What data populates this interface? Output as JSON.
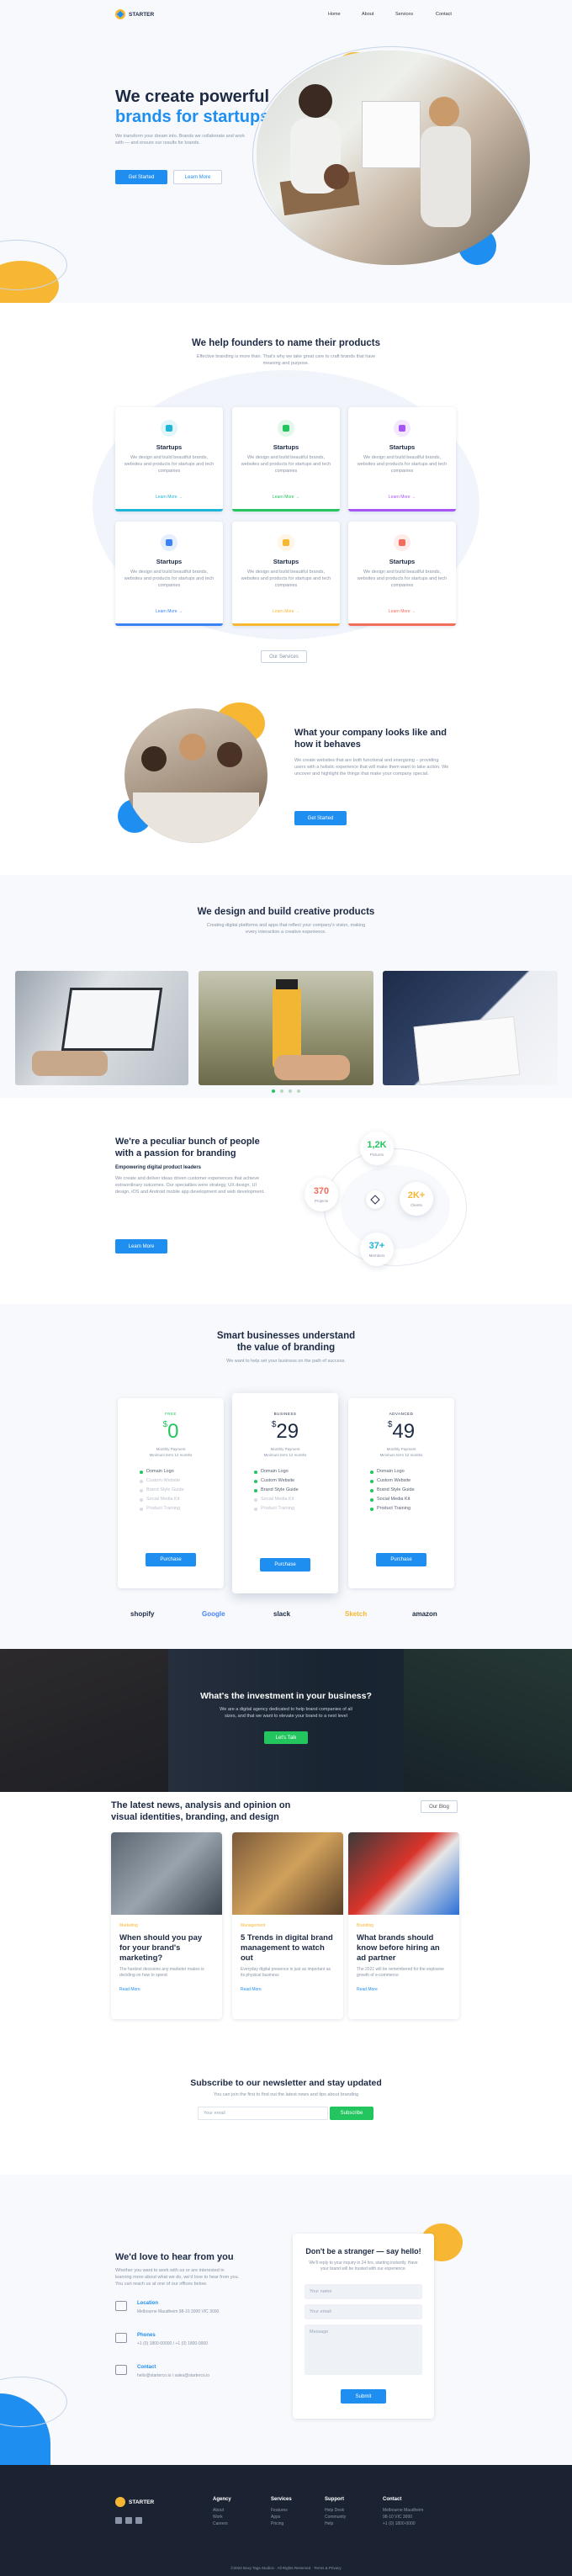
{
  "nav": {
    "brand": "STARTER",
    "items": [
      "Home",
      "About",
      "Services",
      "Contact"
    ]
  },
  "hero": {
    "title_line1": "We create powerful",
    "title_line2": "brands for startups",
    "desc": "We transform your dream into. Brands we collaborate and work with — and ensure our results for brands.",
    "btn_primary": "Get Started",
    "btn_secondary": "Learn More"
  },
  "services": {
    "title": "We help founders to name their products",
    "desc": "Effective branding is more than. That's why we take great care to craft brands that have meaning and purpose.",
    "items": [
      {
        "title": "Startups",
        "desc": "We design and build beautiful brands, websites and products for startups and tech companies",
        "link": "Learn More →",
        "color": "#1fb5d9"
      },
      {
        "title": "Startups",
        "desc": "We design and build beautiful brands, websites and products for startups and tech companies",
        "link": "Learn More →",
        "color": "#22c55e"
      },
      {
        "title": "Startups",
        "desc": "We design and build beautiful brands, websites and products for startups and tech companies",
        "link": "Learn More →",
        "color": "#a855f7"
      },
      {
        "title": "Startups",
        "desc": "We design and build beautiful brands, websites and products for startups and tech companies",
        "link": "Learn More →",
        "color": "#3b82f6"
      },
      {
        "title": "Startups",
        "desc": "We design and build beautiful brands, websites and products for startups and tech companies",
        "link": "Learn More →",
        "color": "#f7b733"
      },
      {
        "title": "Startups",
        "desc": "We design and build beautiful brands, websites and products for startups and tech companies",
        "link": "Learn More →",
        "color": "#f26d5b"
      }
    ],
    "btn": "Our Services"
  },
  "about": {
    "title_line1": "What your company looks like and",
    "title_line2": "how it behaves",
    "desc": "We create websites that are both functional and energizing – providing users with a holistic experience that will make them want to take action. We uncover and highlight the things that make your company special.",
    "btn": "Get Started"
  },
  "products": {
    "title": "We design and build creative products",
    "desc": "Creating digital platforms and apps that reflect your company's vision, making every interaction a creative experience."
  },
  "team": {
    "title_line1": "We're a peculiar bunch of people",
    "title_line2": "with a passion for branding",
    "subtitle": "Empowering digital product leaders",
    "desc": "We create and deliver ideas driven customer experiences that achieve extraordinary outcomes. Our specialties were strategy, UX design, UI design, iOS and Android mobile app development and web development.",
    "btn": "Learn More",
    "stats": [
      {
        "value": "1,2K",
        "label": "Pictures",
        "color": "#22c55e"
      },
      {
        "value": "370",
        "label": "Projects",
        "color": "#f26d5b"
      },
      {
        "value": "2K+",
        "label": "Clients",
        "color": "#f7b733"
      },
      {
        "value": "37+",
        "label": "Members",
        "color": "#1fb5d9"
      }
    ]
  },
  "pricing": {
    "title_line1": "Smart businesses understand",
    "title_line2": "the value of branding",
    "desc": "We want to help set your business on the path of success.",
    "plans": [
      {
        "name": "FREE",
        "price": "0",
        "sub1": "Monthly Payment",
        "sub2": "Minimum term 12 months",
        "color": "#22c55e",
        "features": [
          "Domain Logo",
          "Custom Website",
          "Brand Style Guide",
          "Social Media Kit",
          "Product Training"
        ],
        "on": [
          true,
          false,
          false,
          false,
          false
        ],
        "btn": "Purchase"
      },
      {
        "name": "BUSINESS",
        "price": "29",
        "sub1": "Monthly Payment",
        "sub2": "Minimum term 12 months",
        "color": "#1d2a44",
        "features": [
          "Domain Logo",
          "Custom Website",
          "Brand Style Guide",
          "Social Media Kit",
          "Product Training"
        ],
        "on": [
          true,
          true,
          true,
          false,
          false
        ],
        "btn": "Purchase"
      },
      {
        "name": "ADVANCED",
        "price": "49",
        "sub1": "Monthly Payment",
        "sub2": "Minimum term 12 months",
        "color": "#1d2a44",
        "features": [
          "Domain Logo",
          "Custom Website",
          "Brand Style Guide",
          "Social Media Kit",
          "Product Training"
        ],
        "on": [
          true,
          true,
          true,
          true,
          true
        ],
        "btn": "Purchase"
      }
    ],
    "currency": "$"
  },
  "logos": [
    "shopify",
    "Google",
    "slack",
    "Sketch",
    "amazon"
  ],
  "cta": {
    "title": "What's the investment in your business?",
    "desc": "We are a digital agency dedicated to help brand companies of all sizes, and that we want to elevate your brand to a next level",
    "btn": "Let's Talk"
  },
  "blog": {
    "title_line1": "The latest news, analysis and opinion on",
    "title_line2": "visual identities, branding, and design",
    "btn": "Our Blog",
    "posts": [
      {
        "cat": "Marketing",
        "title": "When should you pay for your brand's marketing?",
        "desc": "The hardest decisions any marketer makes is deciding on how to spend",
        "link": "Read More"
      },
      {
        "cat": "Management",
        "title": "5 Trends in digital brand management to watch out",
        "desc": "Everyday digital presence is just as important as its physical business",
        "link": "Read More"
      },
      {
        "cat": "Branding",
        "title": "What brands should know before hiring an ad partner",
        "desc": "The 2021 will be remembered for the explosive growth of e-commerce",
        "link": "Read More"
      }
    ]
  },
  "newsletter": {
    "title": "Subscribe to our newsletter and stay updated",
    "desc": "You can join the first to find out the latest news and tips about branding",
    "placeholder": "Your email",
    "btn": "Subscribe"
  },
  "contact": {
    "title": "We'd love to hear from you",
    "desc": "Whether you want to work with us or are interested in learning more about what we do, we'd love to hear from you. You can reach us at one of our offices below.",
    "items": [
      {
        "title": "Location",
        "desc": "Melbourne Maudheim 98-10 3000 VIC 3000"
      },
      {
        "title": "Phones",
        "desc": "+1 (0) 1800-00000 / +1 (0) 1800-0000"
      },
      {
        "title": "Contact",
        "desc": "hello@starterco.io / sales@starterco.io"
      }
    ],
    "form_title": "Don't be a stranger — say hello!",
    "form_desc": "We'll reply to your inquiry in 24 hrs, starting instantly. Have your brand will be trusted with our experience.",
    "fields": [
      "Your name",
      "Your email",
      "Message"
    ],
    "btn": "Submit"
  },
  "footer": {
    "brand": "STARTER",
    "cols": [
      {
        "title": "Agency",
        "links": [
          "About",
          "Work",
          "Careers"
        ]
      },
      {
        "title": "Services",
        "links": [
          "Features",
          "Apps",
          "Pricing"
        ]
      },
      {
        "title": "Support",
        "links": [
          "Help Desk",
          "Community",
          "Help"
        ]
      },
      {
        "title": "Contact",
        "links": [
          "Melbourne Maudheim",
          "98-10 VIC 3000",
          "+1 (0) 1800-0000"
        ]
      }
    ],
    "copyright": "©2022 Boxy Tags Studios · All Rights Reserved · Terms & Privacy"
  },
  "colors": {
    "accent": "#1f8ef1",
    "navy": "#1d2a44",
    "yellow": "#f7b733",
    "green": "#22c55e",
    "dark": "#1b2333"
  }
}
